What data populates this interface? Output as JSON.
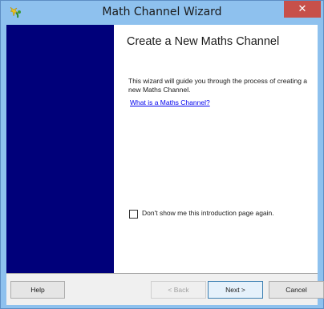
{
  "window": {
    "title": "Math Channel Wizard",
    "close_label": "✕"
  },
  "page": {
    "heading": "Create a New Maths Channel",
    "description": "This wizard will guide you through the process of creating a new Maths Channel.",
    "link_text": "What is a Maths Channel?",
    "checkbox_label": "Don't show me this introduction page again.",
    "checkbox_checked": false
  },
  "buttons": {
    "help": "Help",
    "back": "< Back",
    "next": "Next >",
    "cancel": "Cancel"
  },
  "colors": {
    "titlebar": "#8ec1ee",
    "sidebar": "#00007a",
    "close": "#c7504a",
    "link": "#0000ee"
  },
  "icons": {
    "app": "wizard-app-icon"
  }
}
